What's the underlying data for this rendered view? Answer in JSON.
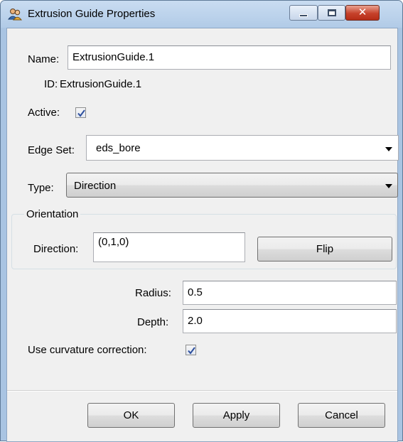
{
  "window": {
    "title": "Extrusion Guide Properties",
    "icons": {
      "app": "users-icon",
      "minimize": "minimize-icon",
      "maximize": "maximize-icon",
      "close": "close-icon"
    }
  },
  "form": {
    "name_label": "Name:",
    "name_value": "ExtrusionGuide.1",
    "id_label": "ID:",
    "id_value": "ExtrusionGuide.1",
    "active_label": "Active:",
    "active_checked": true,
    "edge_set_label": "Edge Set:",
    "edge_set_value": "eds_bore",
    "type_label": "Type:",
    "type_value": "Direction"
  },
  "orientation": {
    "group_label": "Orientation",
    "direction_label": "Direction:",
    "direction_value": "(0,1,0)",
    "flip_label": "Flip"
  },
  "params": {
    "radius_label": "Radius:",
    "radius_value": "0.5",
    "depth_label": "Depth:",
    "depth_value": "2.0",
    "curvature_label": "Use curvature correction:",
    "curvature_checked": true
  },
  "buttons": {
    "ok": "OK",
    "apply": "Apply",
    "cancel": "Cancel"
  },
  "colors": {
    "frame": "#a9c4e2",
    "client": "#f0f0f0",
    "close_button": "#c6412a"
  }
}
